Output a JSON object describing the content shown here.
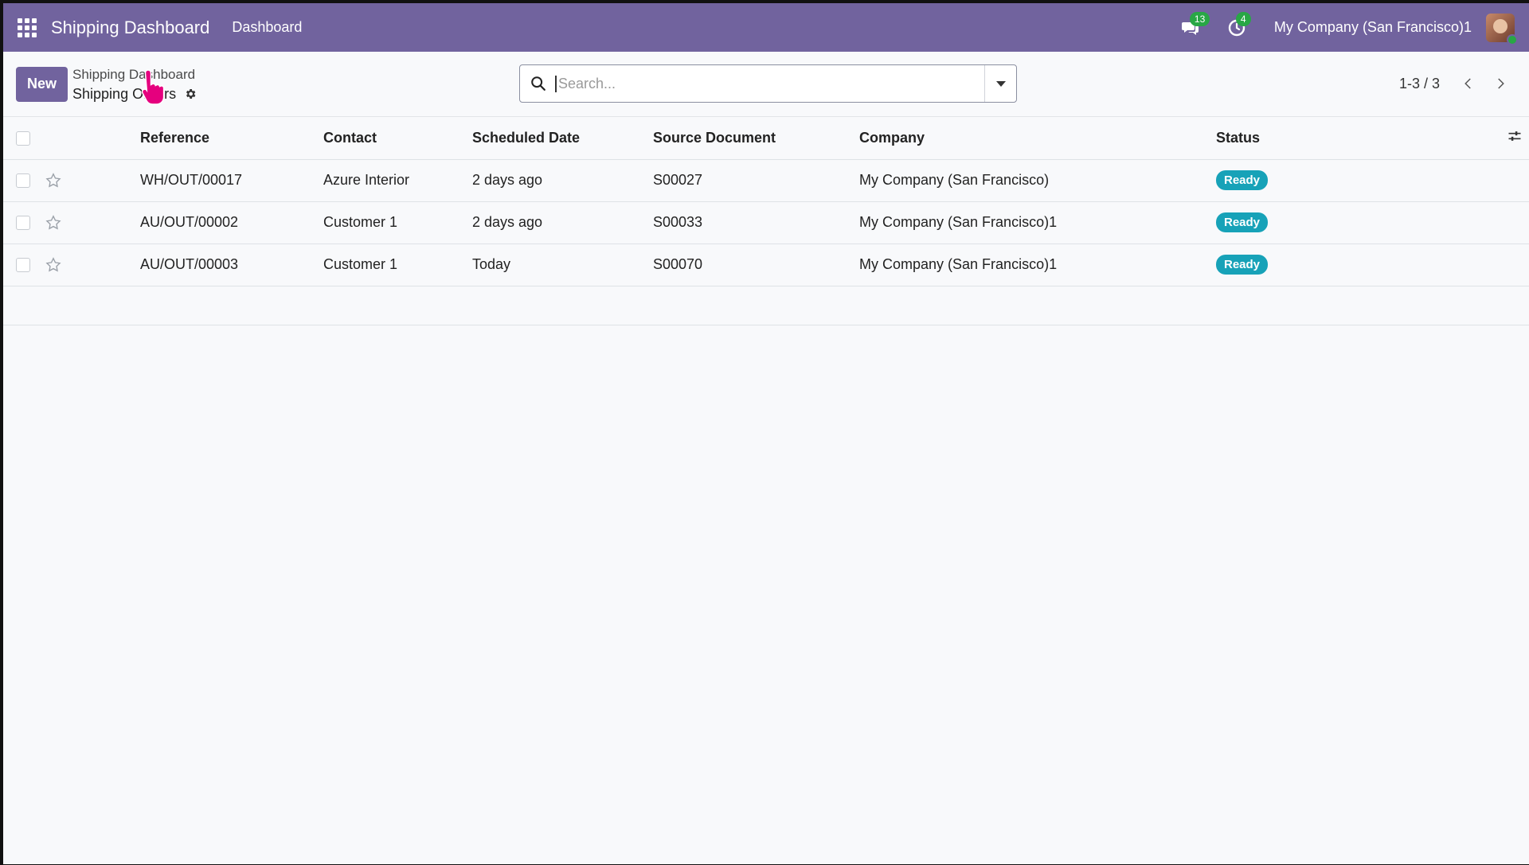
{
  "navbar": {
    "brand": "Shipping Dashboard",
    "menu": [
      "Dashboard"
    ],
    "messages_count": "13",
    "activities_count": "4",
    "company": "My Company (San Francisco)1"
  },
  "control": {
    "new_label": "New",
    "breadcrumb_parent": "Shipping Dashboard",
    "breadcrumb_current": "Shipping Orders",
    "search_placeholder": "Search...",
    "pager": "1-3 / 3"
  },
  "table": {
    "headers": {
      "reference": "Reference",
      "contact": "Contact",
      "scheduled_date": "Scheduled Date",
      "source_document": "Source Document",
      "company": "Company",
      "status": "Status"
    },
    "rows": [
      {
        "reference": "WH/OUT/00017",
        "contact": "Azure Interior",
        "scheduled_date": "2 days ago",
        "source_document": "S00027",
        "company": "My Company (San Francisco)",
        "status": "Ready"
      },
      {
        "reference": "AU/OUT/00002",
        "contact": "Customer 1",
        "scheduled_date": "2 days ago",
        "source_document": "S00033",
        "company": "My Company (San Francisco)1",
        "status": "Ready"
      },
      {
        "reference": "AU/OUT/00003",
        "contact": "Customer 1",
        "scheduled_date": "Today",
        "source_document": "S00070",
        "company": "My Company (San Francisco)1",
        "status": "Ready"
      }
    ]
  },
  "colors": {
    "brand": "#71639e",
    "status_ready": "#17a2b8",
    "date_late": "#c23b3b",
    "date_today": "#9a7a17",
    "badge": "#28a745"
  },
  "icons": [
    "apps-grid-icon",
    "chat-icon",
    "clock-icon",
    "gear-icon",
    "search-icon",
    "caret-down-icon",
    "chevron-left-icon",
    "chevron-right-icon",
    "star-icon",
    "optional-columns-icon",
    "pointer-cursor-icon"
  ]
}
